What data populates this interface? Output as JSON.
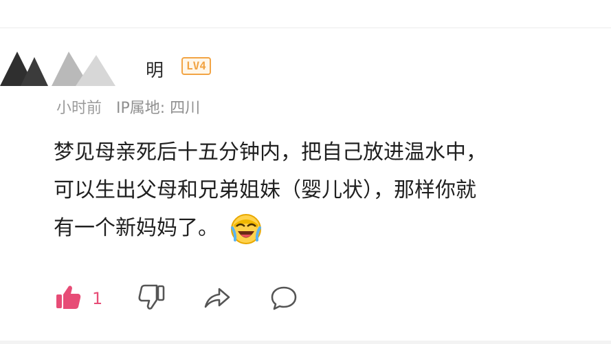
{
  "comment": {
    "username": "明",
    "level": "LV4",
    "time": "小时前",
    "ip_location": "IP属地: 四川",
    "text_lines": [
      "梦见母亲死后十五分钟内，把自己放进温水中，",
      "可以生出父母和兄弟姐妹（婴儿状），那样你就",
      "有一个新妈妈了。"
    ],
    "emoji": "laughing-crying-emoji",
    "like_count": "1"
  },
  "colors": {
    "like": "#e74c76",
    "level_badge": "#f2a444",
    "meta_text": "#8f8f8f",
    "body_text": "#1f1f1f"
  },
  "icons": [
    "thumbs-up-icon",
    "thumbs-down-icon",
    "share-icon",
    "comment-icon"
  ]
}
